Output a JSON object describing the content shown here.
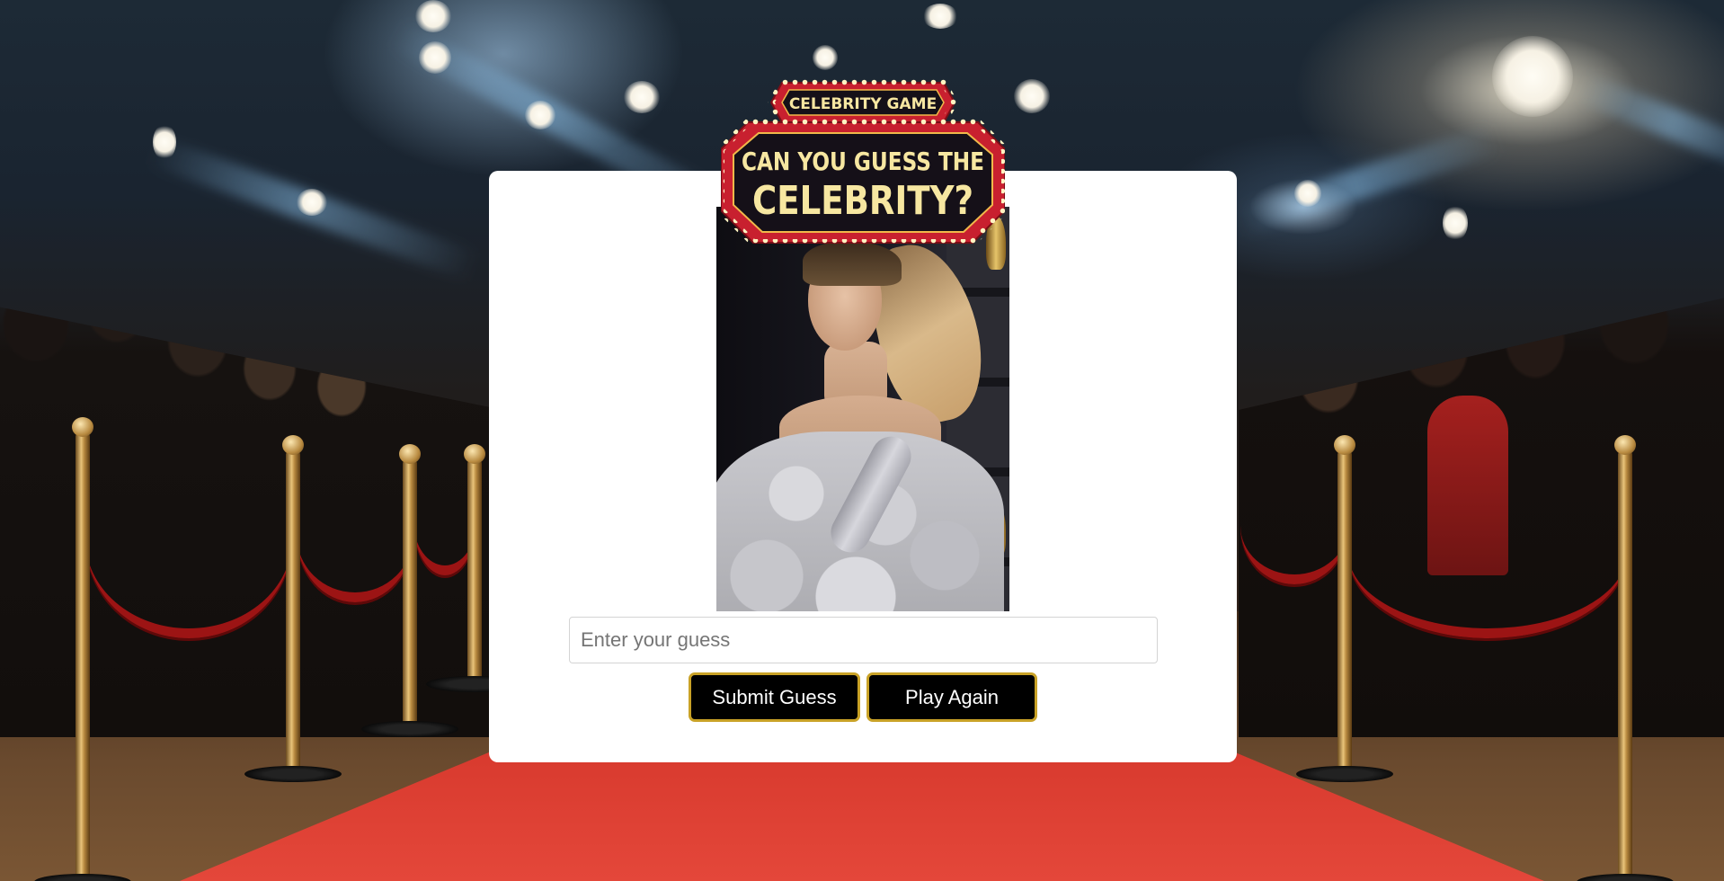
{
  "logo": {
    "tag_text": "CELEBRITY GAME",
    "title_line1": "CAN YOU GUESS THE",
    "title_line2": "CELEBRITY?"
  },
  "game": {
    "guess_placeholder": "Enter your guess",
    "guess_value": "",
    "submit_label": "Submit Guess",
    "play_again_label": "Play Again"
  },
  "colors": {
    "button_bg": "#000000",
    "button_border": "#c9a227",
    "marquee_red": "#d8283a",
    "marquee_text": "#f7e7a1",
    "card_bg": "#ffffff"
  }
}
